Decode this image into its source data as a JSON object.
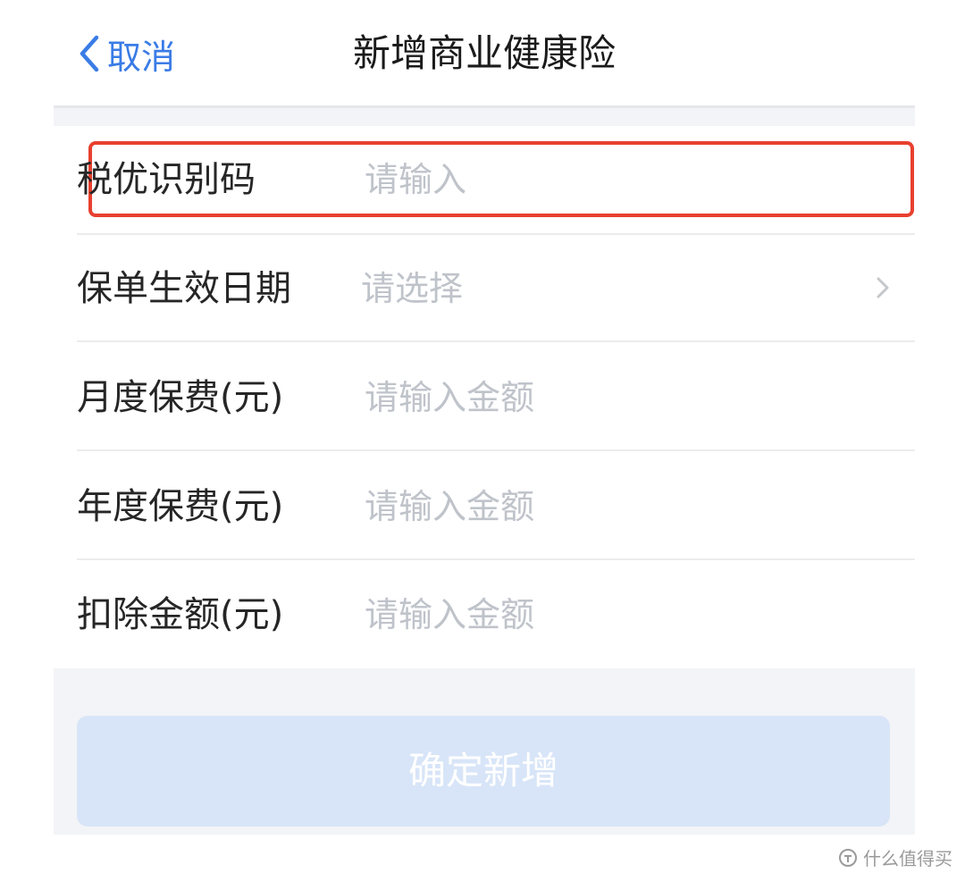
{
  "nav": {
    "back_label": "取消",
    "title": "新增商业健康险"
  },
  "form": {
    "rows": [
      {
        "label": "税优识别码",
        "placeholder": "请输入",
        "type": "input",
        "highlighted": true
      },
      {
        "label": "保单生效日期",
        "placeholder": "请选择",
        "type": "select",
        "icon": "chevron-right-icon"
      },
      {
        "label": "月度保费(元)",
        "placeholder": "请输入金额",
        "type": "input"
      },
      {
        "label": "年度保费(元)",
        "placeholder": "请输入金额",
        "type": "input"
      },
      {
        "label": "扣除金额(元)",
        "placeholder": "请输入金额",
        "type": "input"
      }
    ]
  },
  "confirm_button": {
    "label": "确定新增"
  },
  "watermark": {
    "text": "什么值得买"
  },
  "colors": {
    "accent": "#3a7ce6",
    "highlight_border": "#e8402f",
    "placeholder": "#bfc3ca",
    "button_disabled": "#d8e5f8",
    "background_gray": "#f3f4f7"
  }
}
